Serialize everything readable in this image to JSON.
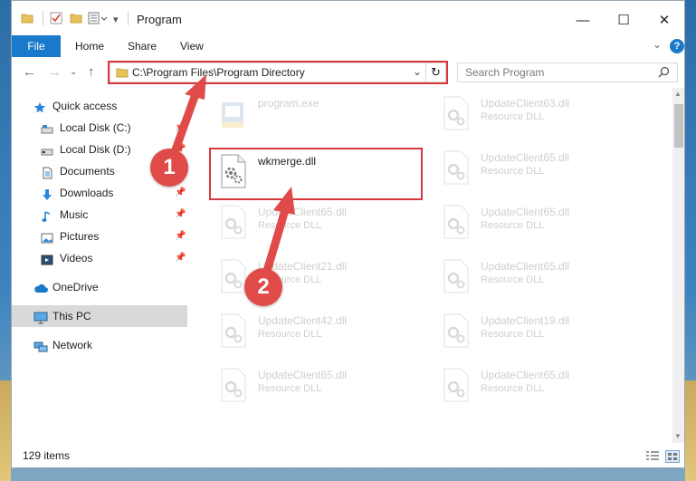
{
  "window": {
    "title": "Program",
    "controls": {
      "minimize": "—",
      "maximize": "☐",
      "close": "✕"
    }
  },
  "ribbon": {
    "tabs": [
      {
        "label": "File"
      },
      {
        "label": "Home"
      },
      {
        "label": "Share"
      },
      {
        "label": "View"
      }
    ],
    "help_label": "?"
  },
  "address": {
    "path": "C:\\Program Files\\Program Directory",
    "dropdown": "⌄",
    "refresh": "↻"
  },
  "search": {
    "placeholder": "Search Program"
  },
  "sidebar": {
    "items": [
      {
        "label": "Quick access",
        "icon": "star-icon"
      },
      {
        "label": "Local Disk (C:)",
        "icon": "drive-icon"
      },
      {
        "label": "Local Disk (D:)",
        "icon": "drive-icon"
      },
      {
        "label": "Documents",
        "icon": "documents-icon"
      },
      {
        "label": "Downloads",
        "icon": "download-icon"
      },
      {
        "label": "Music",
        "icon": "music-icon"
      },
      {
        "label": "Pictures",
        "icon": "pictures-icon"
      },
      {
        "label": "Videos",
        "icon": "videos-icon"
      },
      {
        "label": "OneDrive",
        "icon": "cloud-icon"
      },
      {
        "label": "This PC",
        "icon": "computer-icon"
      },
      {
        "label": "Network",
        "icon": "network-icon"
      }
    ]
  },
  "files": [
    {
      "name": "program.exe",
      "type": ""
    },
    {
      "name": "wkmerge.dll",
      "type": ""
    },
    {
      "name": "UpdateClient65.dll",
      "type": "Resource DLL"
    },
    {
      "name": "UpdateClient21.dll",
      "type": "Resource DLL"
    },
    {
      "name": "UpdateClient42.dll",
      "type": "Resource DLL"
    },
    {
      "name": "UpdateClient65.dll",
      "type": "Resource DLL"
    },
    {
      "name": "UpdateClient63.dll",
      "type": "Resource DLL"
    },
    {
      "name": "UpdateClient65.dll",
      "type": "Resource DLL"
    },
    {
      "name": "UpdateClient65.dll",
      "type": "Resource DLL"
    },
    {
      "name": "UpdateClient65.dll",
      "type": "Resource DLL"
    },
    {
      "name": "UpdateClient19.dll",
      "type": "Resource DLL"
    },
    {
      "name": "UpdateClient65.dll",
      "type": "Resource DLL"
    }
  ],
  "status": {
    "item_count": "129 items"
  },
  "annotations": {
    "step1": "1",
    "step2": "2",
    "color": "#d9363e"
  },
  "colors": {
    "accent": "#1979ca",
    "selected_bg": "#d9d9d9"
  }
}
